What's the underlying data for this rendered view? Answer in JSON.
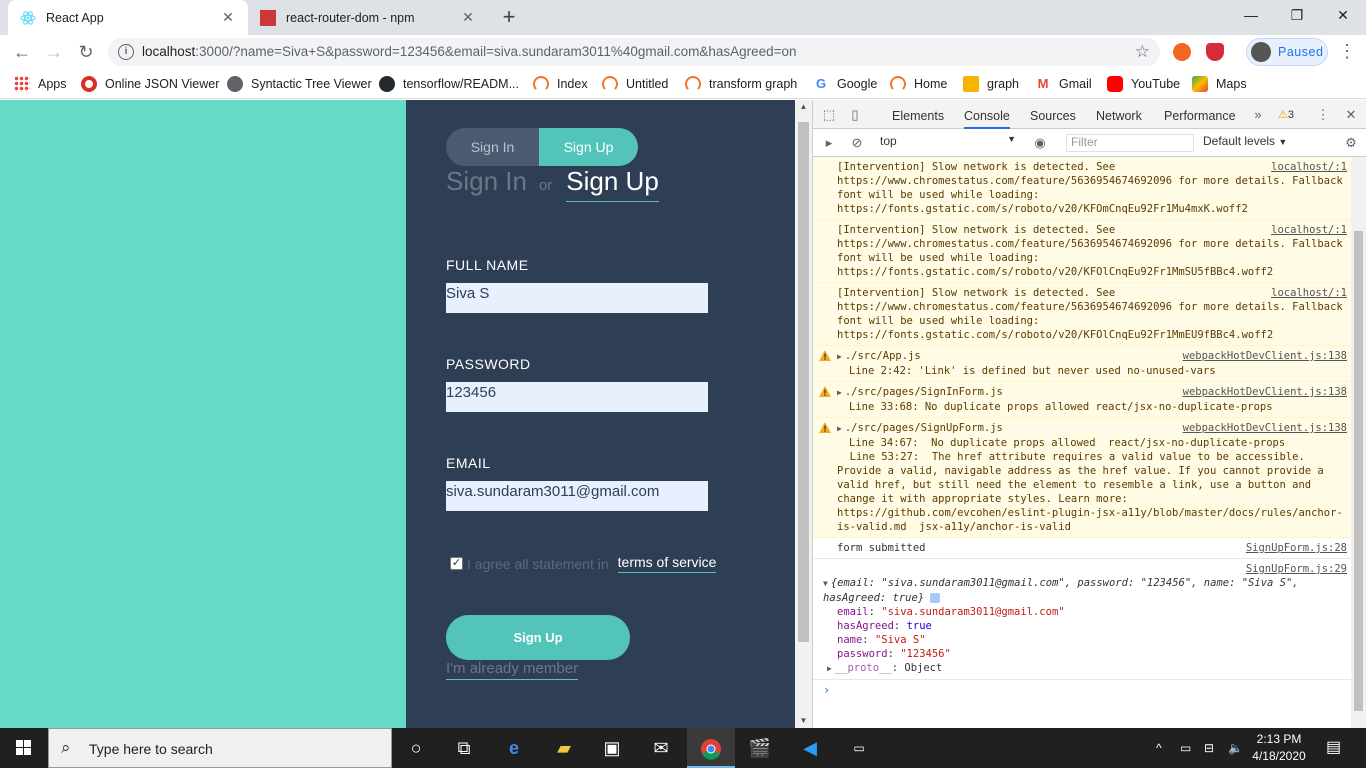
{
  "browser": {
    "tabs": [
      {
        "title": "React App",
        "active": true
      },
      {
        "title": "react-router-dom - npm",
        "active": false
      }
    ],
    "url_host": "localhost",
    "url_rest": ":3000/?name=Siva+S&password=123456&email=siva.sundaram3011%40gmail.com&hasAgreed=on",
    "profile_label": "Paused",
    "bookmarks": [
      "Apps",
      "Online JSON Viewer",
      "Syntactic Tree Viewer",
      "tensorflow/READM...",
      "Index",
      "Untitled",
      "transform graph",
      "Google",
      "Home",
      "graph",
      "Gmail",
      "YouTube",
      "Maps"
    ]
  },
  "form": {
    "switch_signin": "Sign In",
    "switch_signup": "Sign Up",
    "heading_signin": "Sign In",
    "heading_or": "or",
    "heading_signup": "Sign Up",
    "fullname_label": "FULL NAME",
    "fullname_value": "Siva S",
    "password_label": "PASSWORD",
    "password_value": "123456",
    "email_label": "EMAIL",
    "email_value": "siva.sundaram3011@gmail.com",
    "agree_text": "I agree all statement in",
    "terms_link": "terms of service",
    "submit_label": "Sign Up",
    "member_link": "I'm already member"
  },
  "devtools": {
    "tabs": [
      "Elements",
      "Console",
      "Sources",
      "Network",
      "Performance"
    ],
    "active_tab": "Console",
    "warning_count": "3",
    "context": "top",
    "filter_placeholder": "Filter",
    "levels": "Default levels",
    "messages": [
      {
        "text": "[Intervention] Slow network is detected. See https://www.chromestatus.com/feature/5636954674692096 for more details. Fallback font will be used while loading: https://fonts.gstatic.com/s/roboto/v20/KFOmCnqEu92Fr1Mu4mxK.woff2",
        "src": "localhost/:1"
      },
      {
        "text": "[Intervention] Slow network is detected. See https://www.chromestatus.com/feature/5636954674692096 for more details. Fallback font will be used while loading: https://fonts.gstatic.com/s/roboto/v20/KFOlCnqEu92Fr1MmSU5fBBc4.woff2",
        "src": "localhost/:1"
      },
      {
        "text": "[Intervention] Slow network is detected. See https://www.chromestatus.com/feature/5636954674692096 for more details. Fallback font will be used while loading: https://fonts.gstatic.com/s/roboto/v20/KFOlCnqEu92Fr1MmEU9fBBc4.woff2",
        "src": "localhost/:1"
      },
      {
        "file": "./src/App.js",
        "detail": "Line 2:42:  'Link' is defined but never used  no-unused-vars",
        "src": "webpackHotDevClient.js:138"
      },
      {
        "file": "./src/pages/SignInForm.js",
        "detail": "Line 33:68:  No duplicate props allowed  react/jsx-no-duplicate-props",
        "src": "webpackHotDevClient.js:138"
      },
      {
        "file": "./src/pages/SignUpForm.js",
        "detail": "Line 34:67:  No duplicate props allowed  react/jsx-no-duplicate-props\n  Line 53:27:  The href attribute requires a valid value to be accessible. Provide a valid, navigable address as the href value. If you cannot provide a valid href, but still need the element to resemble a link, use a button and change it with appropriate styles. Learn more: https://github.com/evcohen/eslint-plugin-jsx-a11y/blob/master/docs/rules/anchor-is-valid.md  jsx-a11y/anchor-is-valid",
        "src": "webpackHotDevClient.js:138"
      }
    ],
    "log_submitted": "form submitted",
    "log_submitted_src": "SignUpForm.js:28",
    "log_obj_src": "SignUpForm.js:29",
    "obj_preview": "{email: \"siva.sundaram3011@gmail.com\", password: \"123456\", name: \"Siva S\", hasAgreed: true}",
    "obj_props": [
      {
        "key": "email",
        "value": "\"siva.sundaram3011@gmail.com\""
      },
      {
        "key": "hasAgreed",
        "value": "true"
      },
      {
        "key": "name",
        "value": "\"Siva S\""
      },
      {
        "key": "password",
        "value": "\"123456\""
      },
      {
        "key": "__proto__",
        "value": "Object"
      }
    ]
  },
  "taskbar": {
    "search_placeholder": "Type here to search",
    "time": "2:13 PM",
    "date": "4/18/2020"
  }
}
